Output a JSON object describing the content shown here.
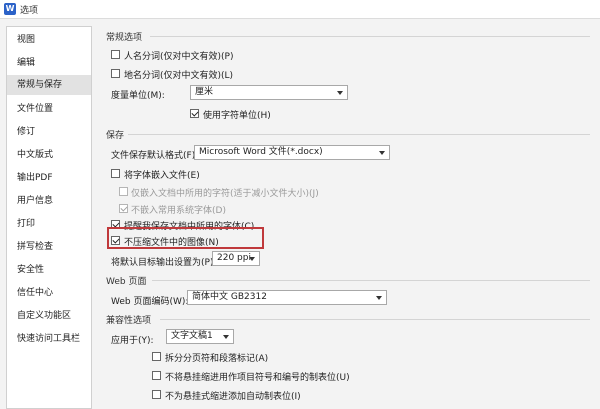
{
  "window": {
    "title": "选项",
    "icon": "wps-writer-icon"
  },
  "sidebar": {
    "items": [
      {
        "label": "视图"
      },
      {
        "label": "编辑"
      },
      {
        "label": "常规与保存",
        "active": true
      },
      {
        "label": "文件位置"
      },
      {
        "label": "修订"
      },
      {
        "label": "中文版式"
      },
      {
        "label": "输出PDF"
      },
      {
        "label": "用户信息"
      },
      {
        "label": "打印"
      },
      {
        "label": "拼写检查"
      },
      {
        "label": "安全性"
      },
      {
        "label": "信任中心"
      },
      {
        "label": "自定义功能区"
      },
      {
        "label": "快速访问工具栏"
      }
    ]
  },
  "general": {
    "title": "常规选项",
    "person_name_split": {
      "label": "人名分词(仅对中文有效)(P)",
      "checked": false
    },
    "place_name_split": {
      "label": "地名分词(仅对中文有效)(L)",
      "checked": false
    },
    "measure_unit": {
      "label": "度量单位(M):",
      "value": "厘米"
    },
    "use_char_unit": {
      "label": "使用字符单位(H)",
      "checked": true
    }
  },
  "save": {
    "title": "保存",
    "default_format": {
      "label": "文件保存默认格式(F):",
      "value": "Microsoft Word 文件(*.docx)"
    },
    "embed_fonts": {
      "label": "将字体嵌入文件(E)",
      "checked": false
    },
    "embed_used_chars": {
      "label": "仅嵌入文档中所用的字符(适于减小文件大小)(J)",
      "checked": false
    },
    "no_embed_system_fonts": {
      "label": "不嵌入常用系统字体(D)",
      "checked": true
    },
    "remind_fonts": {
      "label": "提醒我保存文档中所用的字体(C)",
      "checked": true
    },
    "no_compress_images": {
      "label": "不压缩文件中的图像(N)",
      "checked": true
    },
    "default_ppi": {
      "label": "将默认目标输出设置为(P):",
      "value": "220 ppi"
    }
  },
  "web": {
    "title": "Web 页面",
    "encoding": {
      "label": "Web 页面编码(W):",
      "value": "简体中文 GB2312"
    }
  },
  "compat": {
    "title": "兼容性选项",
    "apply_to": {
      "label": "应用于(Y):",
      "value": "文字文稿1"
    },
    "split_page_para_marks": {
      "label": "拆分分页符和段落标记(A)",
      "checked": false
    },
    "no_hanging_indent_tabs": {
      "label": "不将悬挂缩进用作项目符号和编号的制表位(U)",
      "checked": false
    },
    "no_auto_tab_hanging": {
      "label": "不为悬挂式缩进添加自动制表位(I)",
      "checked": false
    }
  },
  "colors": {
    "highlight": "#c0393b",
    "active_item": "#e2e2e2",
    "icon": "#2b62c8"
  }
}
